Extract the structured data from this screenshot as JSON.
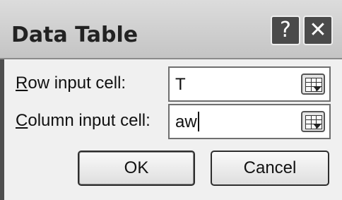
{
  "window": {
    "title": "Data Table",
    "help_glyph": "?",
    "close_glyph": "✕"
  },
  "fields": {
    "row_label_prefix": "R",
    "row_label_rest": "ow input cell:",
    "row_value": "T",
    "column_label_prefix": "C",
    "column_label_rest": "olumn input cell:",
    "column_value": "aw"
  },
  "buttons": {
    "ok": "OK",
    "cancel": "Cancel"
  }
}
